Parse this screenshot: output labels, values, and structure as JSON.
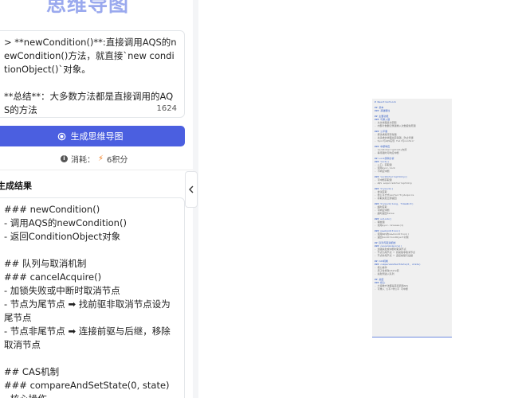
{
  "header": {
    "title": "思维导图"
  },
  "input": {
    "text": "> **newCondition()**:直接调用AQS的newCondition()方法，就直接`new conditionObject()`对象。\n\n**总结**：大多数方法都是直接调用的AQS的方法",
    "char_count": "1624"
  },
  "generate_button": {
    "label": "生成思维导图"
  },
  "cost": {
    "label": "消耗：",
    "amount": "6积分"
  },
  "result": {
    "label": "生成结果",
    "lines": [
      "### newCondition()",
      "- 调用AQS的newCondition()",
      "- 返回ConditionObject对象",
      "",
      "## 队列与取消机制",
      "### cancelAcquire()",
      "- 加锁失败或中断时取消节点",
      "- 节点为尾节点 ➡ 找前驱非取消节点设为尾节点",
      "- 节点非尾节点 ➡ 连接前驱与后继，移除取消节点",
      "",
      "## CAS机制",
      "### compareAndSetState(0, state)",
      "- 核心操作"
    ]
  },
  "preview": {
    "lines": [
      {
        "t": "# ReentrantLock",
        "h": true
      },
      {
        "t": ""
      },
      {
        "t": "## 基本",
        "h": true
      },
      {
        "t": "### 基础属性",
        "h": true
      },
      {
        "t": ""
      },
      {
        "t": "## 主要功能",
        "h": true
      },
      {
        "t": "### 可重入锁",
        "h": true
      },
      {
        "t": "- 允许线程多次获取"
      },
      {
        "t": "- 内部计数器记录锁重入次数避免死锁"
      },
      {
        "t": ""
      },
      {
        "t": "### 公平锁",
        "h": true
      },
      {
        "t": "- 按请求顺序获得锁"
      },
      {
        "t": "- 先请求的线程先获得锁，防止饥饿"
      },
      {
        "t": "- Sync与AQS实现 fair与nonfair"
      },
      {
        "t": ""
      },
      {
        "t": "### 中断响应",
        "h": true
      },
      {
        "t": "- lockInterruptibly支持"
      },
      {
        "t": "- 等待锁时可响应中断"
      },
      {
        "t": ""
      },
      {
        "t": "## Lock源码分析",
        "h": true
      },
      {
        "t": "### lock()",
        "h": true
      },
      {
        "t": "- 入口，获取锁"
      },
      {
        "t": "- 调用sync.lock"
      },
      {
        "t": "- 不响应中断"
      },
      {
        "t": ""
      },
      {
        "t": "### lockInterruptibly()",
        "h": true
      },
      {
        "t": "- 可中断获取锁"
      },
      {
        "t": "- AQS acquireInterruptibly"
      },
      {
        "t": ""
      },
      {
        "t": "### tryLock()",
        "h": true
      },
      {
        "t": "- 尝试获取"
      },
      {
        "t": "- 非公平方式nonfairTryAcquire"
      },
      {
        "t": "- 获取失败立即返回"
      },
      {
        "t": ""
      },
      {
        "t": "### tryLock(long, TimeUnit)",
        "h": true
      },
      {
        "t": "- 超时获取"
      },
      {
        "t": "- 可响应中断"
      },
      {
        "t": "- 超时返回false"
      },
      {
        "t": ""
      },
      {
        "t": "### unlock()",
        "h": true
      },
      {
        "t": "- 释放锁"
      },
      {
        "t": "- 调用sync.release(1)"
      },
      {
        "t": ""
      },
      {
        "t": "### newCondition()",
        "h": true
      },
      {
        "t": "- 调用AQS的newCondition()"
      },
      {
        "t": "- 返回ConditionObject对象"
      },
      {
        "t": ""
      },
      {
        "t": "## 队列与取消机制",
        "h": true
      },
      {
        "t": "### cancelAcquire()",
        "h": true
      },
      {
        "t": "- 加锁失败或中断时取消节点"
      },
      {
        "t": "- 节点为尾节点 ➡ 找前驱非取消节点"
      },
      {
        "t": "- 节点非尾节点 ➡ 连接前驱与后继"
      },
      {
        "t": ""
      },
      {
        "t": "## CAS机制",
        "h": true
      },
      {
        "t": "### compareAndSetState(0, state)",
        "h": true
      },
      {
        "t": "- 核心操作"
      },
      {
        "t": "- 原子性修改state值"
      },
      {
        "t": "- 失败则进入队列"
      },
      {
        "t": ""
      },
      {
        "t": "## 总结",
        "h": true
      },
      {
        "t": "### 核心",
        "h": true
      },
      {
        "t": "- 大多数方法都是直接调用AQS"
      },
      {
        "t": "- 可重入 公平/非公平 可中断"
      }
    ]
  },
  "colors": {
    "primary": "#4b5fe0",
    "title": "#9aa9ee",
    "bolt": "#f27a1a"
  }
}
